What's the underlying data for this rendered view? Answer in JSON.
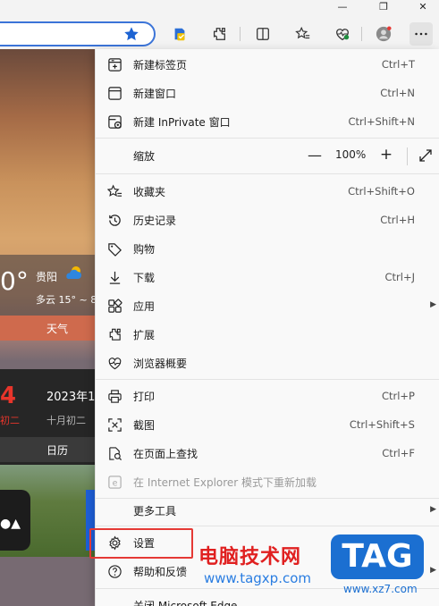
{
  "browser": {
    "caption_buttons": [
      "minimize",
      "restore",
      "close"
    ],
    "toolbar_icons": [
      "favorite-star-icon",
      "shield-extension-icon",
      "extensions-icon",
      "split-screen-icon",
      "favorites-icon",
      "browser-essentials-icon",
      "profile-avatar-icon",
      "more-menu-icon"
    ]
  },
  "background": {
    "weather": {
      "temp": "0°",
      "city": "贵阳",
      "desc": "多云 15° ~ 8",
      "label": "天气"
    },
    "calendar": {
      "day": "4",
      "date": "2023年1",
      "weekday": "初二",
      "lunar": "十月初二",
      "label": "日历"
    }
  },
  "menu": {
    "items": [
      {
        "label": "新建标签页",
        "shortcut": "Ctrl+T",
        "icon": "new-tab-icon"
      },
      {
        "label": "新建窗口",
        "shortcut": "Ctrl+N",
        "icon": "new-window-icon"
      },
      {
        "label": "新建 InPrivate 窗口",
        "shortcut": "Ctrl+Shift+N",
        "icon": "inprivate-window-icon"
      },
      {
        "label": "缩放",
        "zoom_value": "100%",
        "minus": "—",
        "plus": "+",
        "icon": "zoom-icon"
      },
      {
        "label": "收藏夹",
        "shortcut": "Ctrl+Shift+O",
        "icon": "favorites-icon"
      },
      {
        "label": "历史记录",
        "shortcut": "Ctrl+H",
        "icon": "history-icon"
      },
      {
        "label": "购物",
        "shortcut": "",
        "icon": "shopping-tag-icon"
      },
      {
        "label": "下载",
        "shortcut": "Ctrl+J",
        "icon": "download-icon"
      },
      {
        "label": "应用",
        "shortcut": "",
        "submenu": true,
        "icon": "apps-icon"
      },
      {
        "label": "扩展",
        "shortcut": "",
        "icon": "extensions-icon"
      },
      {
        "label": "浏览器概要",
        "shortcut": "",
        "icon": "browser-essentials-icon"
      },
      {
        "label": "打印",
        "shortcut": "Ctrl+P",
        "icon": "print-icon"
      },
      {
        "label": "截图",
        "shortcut": "Ctrl+Shift+S",
        "icon": "screenshot-icon"
      },
      {
        "label": "在页面上查找",
        "shortcut": "Ctrl+F",
        "icon": "find-on-page-icon"
      },
      {
        "label": "在 Internet Explorer 模式下重新加载",
        "shortcut": "",
        "disabled": true,
        "icon": "ie-mode-icon"
      },
      {
        "label": "更多工具",
        "shortcut": "",
        "submenu": true,
        "icon": ""
      },
      {
        "label": "设置",
        "shortcut": "",
        "highlighted": true,
        "icon": "settings-gear-icon"
      },
      {
        "label": "帮助和反馈",
        "shortcut": "",
        "submenu": true,
        "icon": "help-icon"
      },
      {
        "label": "关闭 Microsoft Edge",
        "shortcut": "",
        "icon": ""
      }
    ]
  },
  "watermark": {
    "text": "电脑技术网",
    "url": "www.tagxp.com",
    "tag": "TAG",
    "tag_url": "www.xz7.com"
  },
  "colors": {
    "accent": "#3b74d8",
    "highlight_border": "#e53935",
    "menu_bg": "#f9f9f9",
    "watermark_red": "#e02020",
    "watermark_blue": "#1b6fd1"
  }
}
